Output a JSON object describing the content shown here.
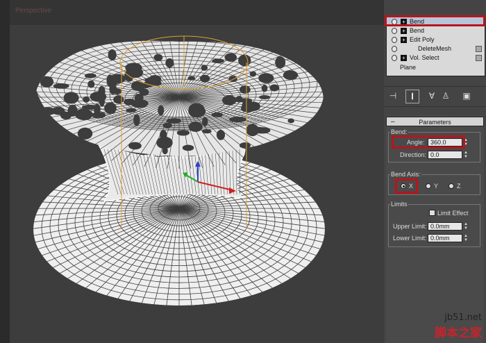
{
  "viewport": {
    "label": "Perspective",
    "colors": {
      "background": "#3d3d3d",
      "wire": "#ffffff",
      "gizmo": "#e0a030"
    }
  },
  "modifier_stack": {
    "items": [
      {
        "label": "Bend",
        "selected": true,
        "has_plus": true,
        "has_box": false
      },
      {
        "label": "Bend",
        "selected": false,
        "has_plus": true,
        "has_box": false
      },
      {
        "label": "Edit Poly",
        "selected": false,
        "has_plus": true,
        "has_box": false
      },
      {
        "label": "DeleteMesh",
        "selected": false,
        "has_plus": false,
        "has_box": true
      },
      {
        "label": "Vol. Select",
        "selected": false,
        "has_plus": true,
        "has_box": true
      }
    ],
    "base_object": "Plane"
  },
  "toolbar": {
    "icons": [
      "pin-stack-icon",
      "show-end-result-icon",
      "make-unique-icon",
      "remove-modifier-icon",
      "configure-modifier-sets-icon"
    ]
  },
  "parameters": {
    "title": "Parameters",
    "bend_group": "Bend:",
    "angle_label": "Angle:",
    "angle_value": "360.0",
    "direction_label": "Direction:",
    "direction_value": "0.0",
    "bend_axis_group": "Bend Axis:",
    "axes": [
      "X",
      "Y",
      "Z"
    ],
    "selected_axis": "X",
    "limits_group": "Limits",
    "limit_effect_label": "Limit Effect",
    "limit_effect_checked": false,
    "upper_limit_label": "Upper Limit:",
    "upper_limit_value": "0.0mm",
    "lower_limit_label": "Lower Limit:",
    "lower_limit_value": "0.0mm"
  },
  "highlight_color": "#b8141c",
  "watermark": {
    "line1": "jb51.net",
    "line2": "脚本之家"
  }
}
